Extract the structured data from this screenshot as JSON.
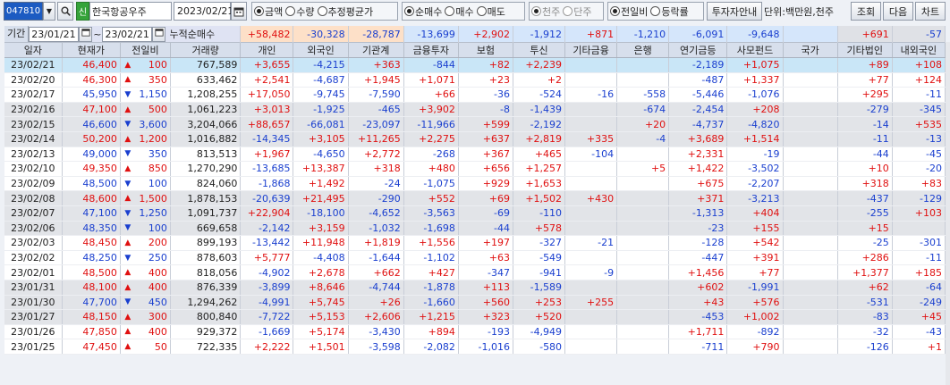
{
  "toolbar": {
    "code": "047810",
    "search_icon": "search-icon",
    "credit_badge": "신",
    "name": "한국항공우주",
    "date": "2023/02/21",
    "unit_group": [
      {
        "label": "금액",
        "selected": true
      },
      {
        "label": "수량",
        "selected": false
      },
      {
        "label": "추정평균가",
        "selected": false
      }
    ],
    "trade_group": [
      {
        "label": "순매수",
        "selected": true
      },
      {
        "label": "매수",
        "selected": false
      },
      {
        "label": "매도",
        "selected": false
      }
    ],
    "share_group": [
      {
        "label": "천주",
        "selected": true
      },
      {
        "label": "단주",
        "selected": false
      }
    ],
    "compare_group": [
      {
        "label": "전일비",
        "selected": true
      },
      {
        "label": "등락률",
        "selected": false
      }
    ],
    "investor_info_btn": "투자자안내",
    "unit_text": "단위:백만원,천주",
    "query_btn": "조회",
    "next_btn": "다음",
    "chart_btn": "차트"
  },
  "period": {
    "label": "기간",
    "from": "23/01/21",
    "sep": "~",
    "to": "23/02/21",
    "cum_label": "누적순매수",
    "cum_values": [
      "+58,482",
      "-30,328",
      "-28,787",
      "-13,699",
      "+2,902",
      "-1,912",
      "+871",
      "-1,210",
      "-6,091",
      "-9,648",
      "",
      "+691",
      "-57"
    ]
  },
  "columns": [
    "일자",
    "현재가",
    "전일비",
    "거래량",
    "개인",
    "외국인",
    "기관계",
    "금융투자",
    "보험",
    "투신",
    "기타금융",
    "은행",
    "연기금등",
    "사모펀드",
    "국가",
    "기타법인",
    "내외국인"
  ],
  "rows": [
    {
      "date": "23/02/21",
      "price": "46,400",
      "dir": "up",
      "chg": "100",
      "vol": "767,589",
      "v": [
        "+3,655",
        "-4,215",
        "+363",
        "-844",
        "+82",
        "+2,239",
        "",
        "",
        "-2,189",
        "+1,075",
        "",
        "+89",
        "+108"
      ]
    },
    {
      "date": "23/02/20",
      "price": "46,300",
      "dir": "up",
      "chg": "350",
      "vol": "633,462",
      "v": [
        "+2,541",
        "-4,687",
        "+1,945",
        "+1,071",
        "+23",
        "+2",
        "",
        "",
        "-487",
        "+1,337",
        "",
        "+77",
        "+124"
      ]
    },
    {
      "date": "23/02/17",
      "price": "45,950",
      "dir": "down",
      "chg": "1,150",
      "vol": "1,208,255",
      "v": [
        "+17,050",
        "-9,745",
        "-7,590",
        "+66",
        "-36",
        "-524",
        "-16",
        "-558",
        "-5,446",
        "-1,076",
        "",
        "+295",
        "-11"
      ]
    },
    {
      "date": "23/02/16",
      "price": "47,100",
      "dir": "up",
      "chg": "500",
      "vol": "1,061,223",
      "v": [
        "+3,013",
        "-1,925",
        "-465",
        "+3,902",
        "-8",
        "-1,439",
        "",
        "-674",
        "-2,454",
        "+208",
        "",
        "-279",
        "-345"
      ]
    },
    {
      "date": "23/02/15",
      "price": "46,600",
      "dir": "down",
      "chg": "3,600",
      "vol": "3,204,066",
      "v": [
        "+88,657",
        "-66,081",
        "-23,097",
        "-11,966",
        "+599",
        "-2,192",
        "",
        "+20",
        "-4,737",
        "-4,820",
        "",
        "-14",
        "+535"
      ]
    },
    {
      "date": "23/02/14",
      "price": "50,200",
      "dir": "up",
      "chg": "1,200",
      "vol": "1,016,882",
      "v": [
        "-14,345",
        "+3,105",
        "+11,265",
        "+2,275",
        "+637",
        "+2,819",
        "+335",
        "-4",
        "+3,689",
        "+1,514",
        "",
        "-11",
        "-13"
      ]
    },
    {
      "date": "23/02/13",
      "price": "49,000",
      "dir": "down",
      "chg": "350",
      "vol": "813,513",
      "v": [
        "+1,967",
        "-4,650",
        "+2,772",
        "-268",
        "+367",
        "+465",
        "-104",
        "",
        "+2,331",
        "-19",
        "",
        "-44",
        "-45"
      ]
    },
    {
      "date": "23/02/10",
      "price": "49,350",
      "dir": "up",
      "chg": "850",
      "vol": "1,270,290",
      "v": [
        "-13,685",
        "+13,387",
        "+318",
        "+480",
        "+656",
        "+1,257",
        "",
        "+5",
        "+1,422",
        "-3,502",
        "",
        "+10",
        "-20"
      ]
    },
    {
      "date": "23/02/09",
      "price": "48,500",
      "dir": "down",
      "chg": "100",
      "vol": "824,060",
      "v": [
        "-1,868",
        "+1,492",
        "-24",
        "-1,075",
        "+929",
        "+1,653",
        "",
        "",
        "+675",
        "-2,207",
        "",
        "+318",
        "+83"
      ]
    },
    {
      "date": "23/02/08",
      "price": "48,600",
      "dir": "up",
      "chg": "1,500",
      "vol": "1,878,153",
      "v": [
        "-20,639",
        "+21,495",
        "-290",
        "+552",
        "+69",
        "+1,502",
        "+430",
        "",
        "+371",
        "-3,213",
        "",
        "-437",
        "-129"
      ]
    },
    {
      "date": "23/02/07",
      "price": "47,100",
      "dir": "down",
      "chg": "1,250",
      "vol": "1,091,737",
      "v": [
        "+22,904",
        "-18,100",
        "-4,652",
        "-3,563",
        "-69",
        "-110",
        "",
        "",
        "-1,313",
        "+404",
        "",
        "-255",
        "+103"
      ]
    },
    {
      "date": "23/02/06",
      "price": "48,350",
      "dir": "down",
      "chg": "100",
      "vol": "669,658",
      "v": [
        "-2,142",
        "+3,159",
        "-1,032",
        "-1,698",
        "-44",
        "+578",
        "",
        "",
        "-23",
        "+155",
        "",
        "+15",
        ""
      ]
    },
    {
      "date": "23/02/03",
      "price": "48,450",
      "dir": "up",
      "chg": "200",
      "vol": "899,193",
      "v": [
        "-13,442",
        "+11,948",
        "+1,819",
        "+1,556",
        "+197",
        "-327",
        "-21",
        "",
        "-128",
        "+542",
        "",
        "-25",
        "-301"
      ]
    },
    {
      "date": "23/02/02",
      "price": "48,250",
      "dir": "down",
      "chg": "250",
      "vol": "878,603",
      "v": [
        "+5,777",
        "-4,408",
        "-1,644",
        "-1,102",
        "+63",
        "-549",
        "",
        "",
        "-447",
        "+391",
        "",
        "+286",
        "-11"
      ]
    },
    {
      "date": "23/02/01",
      "price": "48,500",
      "dir": "up",
      "chg": "400",
      "vol": "818,056",
      "v": [
        "-4,902",
        "+2,678",
        "+662",
        "+427",
        "-347",
        "-941",
        "-9",
        "",
        "+1,456",
        "+77",
        "",
        "+1,377",
        "+185"
      ]
    },
    {
      "date": "23/01/31",
      "price": "48,100",
      "dir": "up",
      "chg": "400",
      "vol": "876,339",
      "v": [
        "-3,899",
        "+8,646",
        "-4,744",
        "-1,878",
        "+113",
        "-1,589",
        "",
        "",
        "+602",
        "-1,991",
        "",
        "+62",
        "-64"
      ]
    },
    {
      "date": "23/01/30",
      "price": "47,700",
      "dir": "down",
      "chg": "450",
      "vol": "1,294,262",
      "v": [
        "-4,991",
        "+5,745",
        "+26",
        "-1,660",
        "+560",
        "+253",
        "+255",
        "",
        "+43",
        "+576",
        "",
        "-531",
        "-249"
      ]
    },
    {
      "date": "23/01/27",
      "price": "48,150",
      "dir": "up",
      "chg": "300",
      "vol": "800,840",
      "v": [
        "-7,722",
        "+5,153",
        "+2,606",
        "+1,215",
        "+323",
        "+520",
        "",
        "",
        "-453",
        "+1,002",
        "",
        "-83",
        "+45"
      ]
    },
    {
      "date": "23/01/26",
      "price": "47,850",
      "dir": "up",
      "chg": "400",
      "vol": "929,372",
      "v": [
        "-1,669",
        "+5,174",
        "-3,430",
        "+894",
        "-193",
        "-4,949",
        "",
        "",
        "+1,711",
        "-892",
        "",
        "-32",
        "-43"
      ]
    },
    {
      "date": "23/01/25",
      "price": "47,450",
      "dir": "up",
      "chg": "50",
      "vol": "722,335",
      "v": [
        "+2,222",
        "+1,501",
        "-3,598",
        "-2,082",
        "-1,016",
        "-580",
        "",
        "",
        "-711",
        "+790",
        "",
        "-126",
        "+1"
      ]
    }
  ],
  "colors": {
    "up": "#e01010",
    "down": "#1a3fcf",
    "selected_row": "#c9e6f7",
    "header_bg": "#d7dfec"
  }
}
